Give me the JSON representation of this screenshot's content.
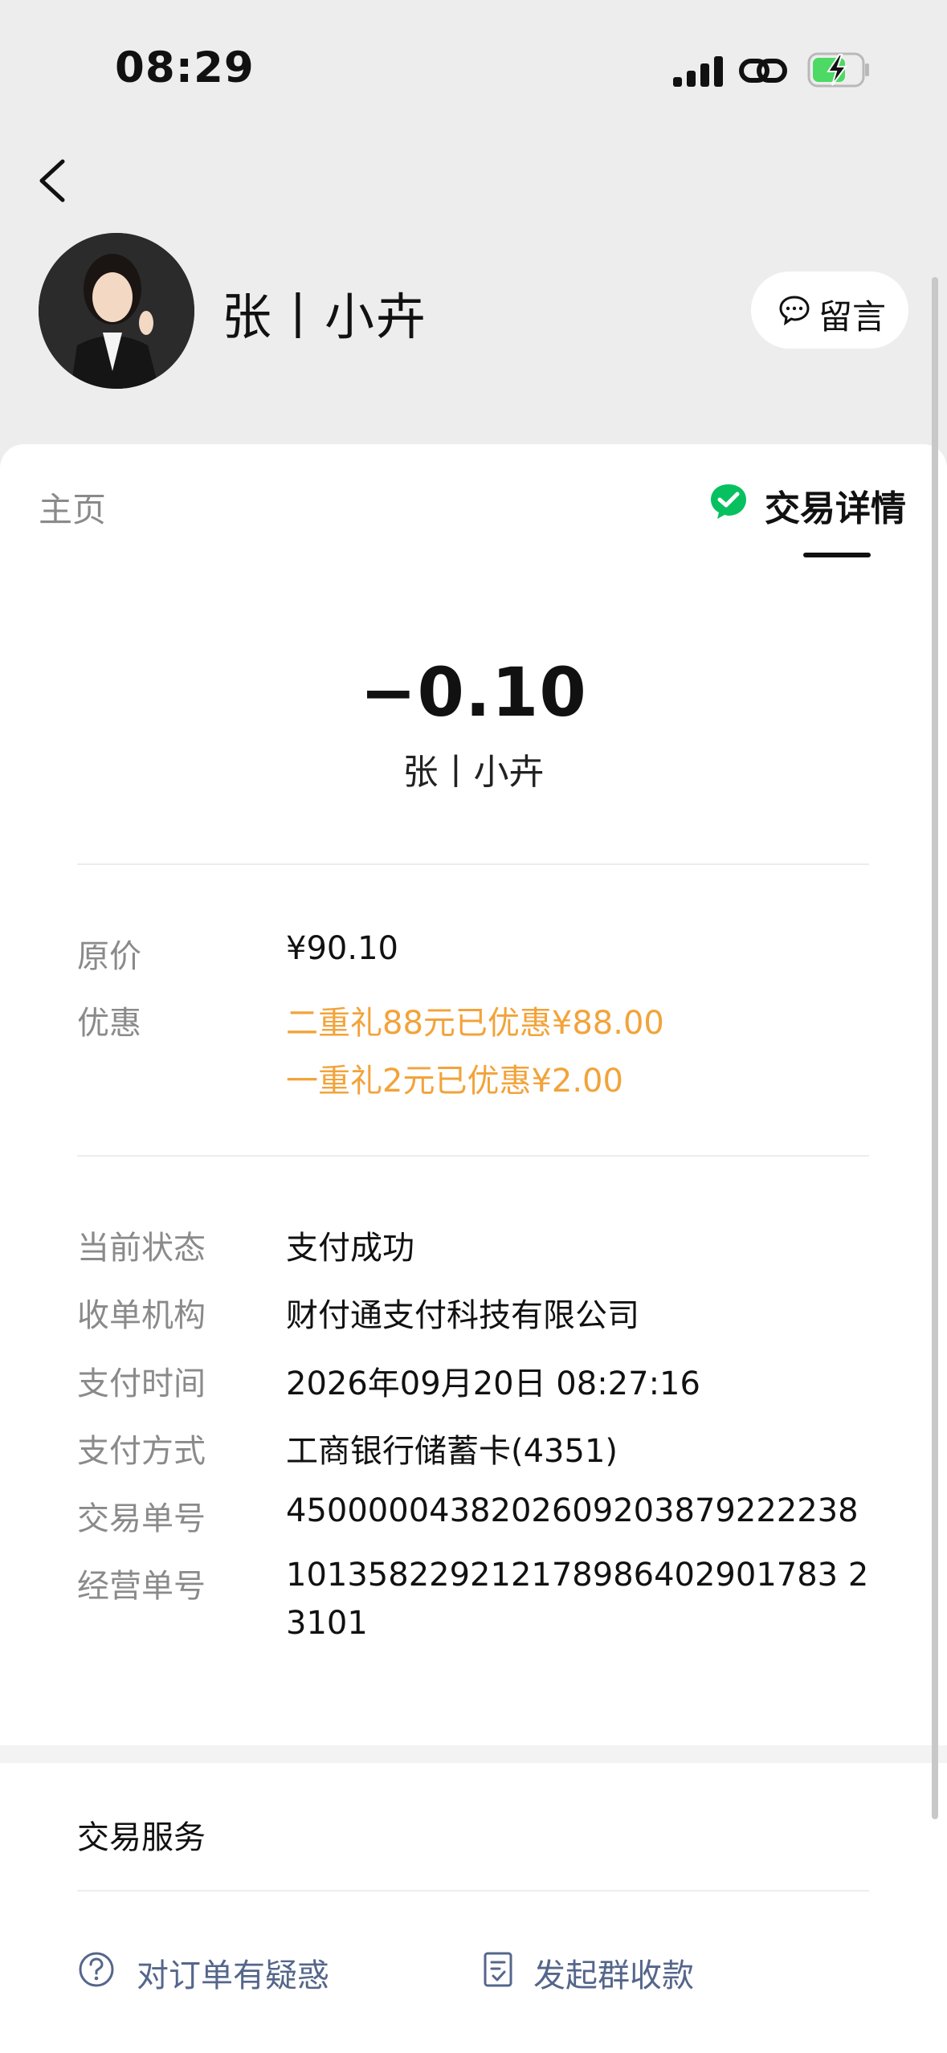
{
  "status_bar": {
    "time": "08:29"
  },
  "header": {
    "contact_name": "张丨小卉",
    "message_button": "留言"
  },
  "tabs": {
    "home": "主页",
    "detail": "交易详情"
  },
  "transaction": {
    "amount": "−0.10",
    "payee": "张丨小卉",
    "original_price_label": "原价",
    "original_price": "¥90.10",
    "discount_label": "优惠",
    "discounts": [
      "二重礼88元已优惠¥88.00",
      "一重礼2元已优惠¥2.00"
    ],
    "details": [
      {
        "label": "当前状态",
        "value": "支付成功"
      },
      {
        "label": "收单机构",
        "value": "财付通支付科技有限公司"
      },
      {
        "label": "支付时间",
        "value": "2026年09月20日 08:27:16"
      },
      {
        "label": "支付方式",
        "value": "工商银行储蓄卡(4351)"
      },
      {
        "label": "交易单号",
        "value": "4500000438202609203879222238"
      },
      {
        "label": "经营单号",
        "value": "101358229212178986402901783 23101"
      }
    ]
  },
  "services": {
    "title": "交易服务",
    "question": "对订单有疑惑",
    "group_collect": "发起群收款"
  },
  "colors": {
    "accent_green": "#07c160",
    "discount_orange": "#f2a33a",
    "link_blue": "#55668b"
  }
}
